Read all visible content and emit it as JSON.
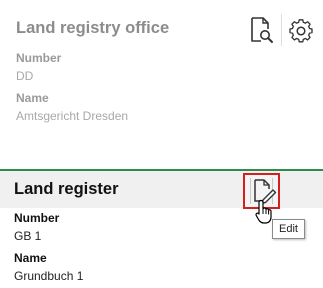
{
  "office": {
    "title": "Land registry office",
    "number_label": "Number",
    "number_value": "DD",
    "name_label": "Name",
    "name_value": "Amtsgericht Dresden",
    "icons": [
      "search-document-icon",
      "gear-icon"
    ]
  },
  "register": {
    "title": "Land register",
    "number_label": "Number",
    "number_value": "GB 1",
    "name_label": "Name",
    "name_value": "Grundbuch 1",
    "edit_icon": "edit-document-icon",
    "tooltip": "Edit"
  },
  "colors": {
    "accent_green": "#2e8b4a",
    "highlight_red": "#d21f1f"
  }
}
